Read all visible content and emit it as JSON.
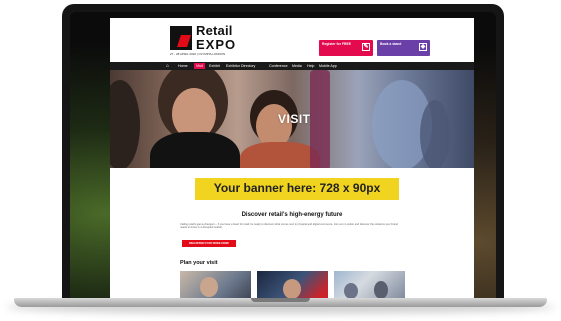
{
  "site": {
    "logo_line1": "Retail",
    "logo_line2": "EXPO",
    "tagline": "27 - 28 APRIL 2022 | OLYMPIA LONDON"
  },
  "header_ctas": {
    "register_label": "Register for FREE",
    "book_label": "Book a stand"
  },
  "nav": {
    "items": [
      "Home",
      "Visit",
      "Exhibit",
      "Exhibitor Directory",
      "Conference",
      "Media",
      "Help",
      "Mobile App"
    ],
    "active_index": 1
  },
  "hero": {
    "title": "VISIT"
  },
  "banner": {
    "text": "Your banner here: 728 x 90px",
    "color": "#f0d41f"
  },
  "content": {
    "discover_heading": "Discover retail's high-energy future",
    "intro_text": "Calling retail's game-changers – if you have a heart for retail, be ready to discover what comes next in physical and digital commerce. Join us in London and discover the solutions your brand needs to thrive in a disrupted market.",
    "register_button": "REGISTER FOR FREE NOW",
    "plan_heading": "Plan your visit"
  },
  "colors": {
    "accent_pink": "#e30b4e",
    "accent_purple": "#6b3fa8",
    "nav_bg": "#1a1a1a",
    "button_red": "#e30b17"
  }
}
